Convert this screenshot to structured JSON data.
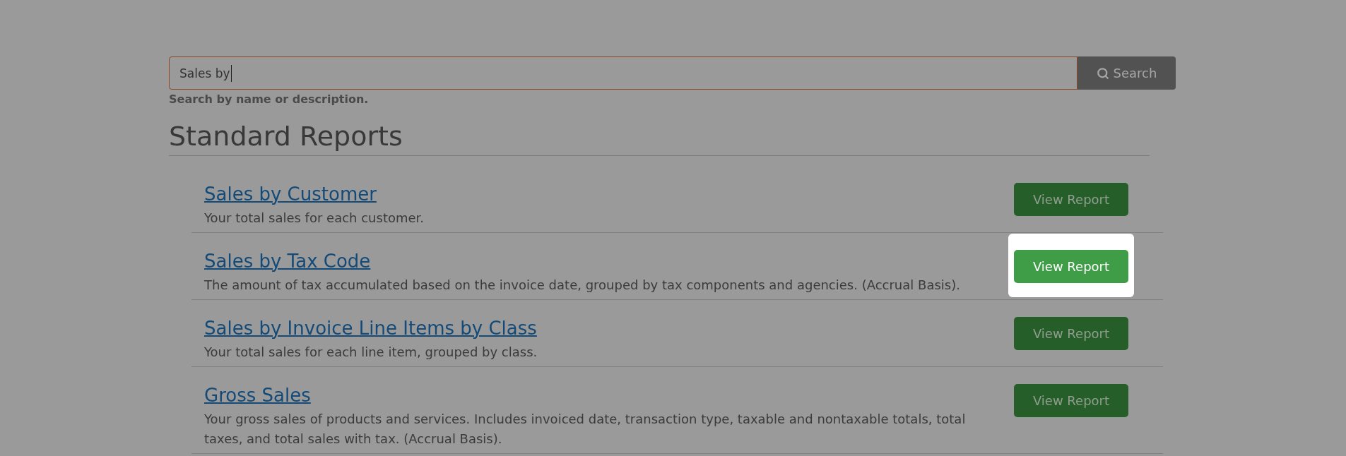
{
  "search": {
    "value": "Sales by",
    "focused": true,
    "hint": "Search by name or description.",
    "button": "Search"
  },
  "section": {
    "title": "Standard Reports"
  },
  "reports": [
    {
      "title": "Sales by Customer",
      "description": "Your total sales for each customer.",
      "button": "View Report",
      "highlighted": false
    },
    {
      "title": "Sales by Tax Code",
      "description": "The amount of tax accumulated based on the invoice date, grouped by tax components and agencies. (Accrual Basis).",
      "button": "View Report",
      "highlighted": true
    },
    {
      "title": "Sales by Invoice Line Items by Class",
      "description": "Your total sales for each line item, grouped by class.",
      "button": "View Report",
      "highlighted": false
    },
    {
      "title": "Gross Sales",
      "description": "Your gross sales of products and services. Includes invoiced date, transaction type, taxable and nontaxable totals, total taxes, and total sales with tax. (Accrual Basis).",
      "button": "View Report",
      "highlighted": false
    }
  ]
}
